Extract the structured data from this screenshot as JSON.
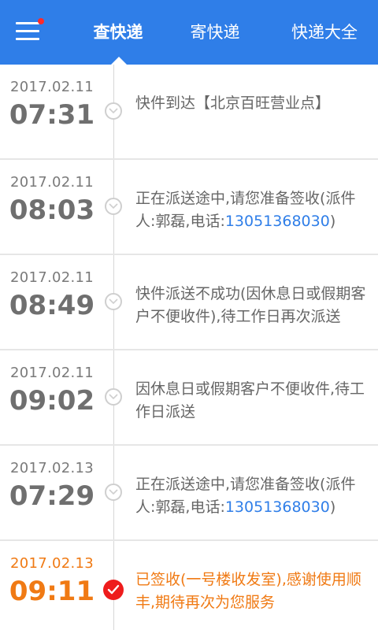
{
  "header": {
    "tabs": [
      {
        "label": "查快递",
        "active": true
      },
      {
        "label": "寄快递",
        "active": false
      },
      {
        "label": "快递大全",
        "active": false
      }
    ],
    "menu_icon": "hamburger-menu-icon",
    "notification_dot_color": "#ff2a2a",
    "accent_color": "#2f7ee8"
  },
  "timeline": [
    {
      "date": "2017.02.11",
      "time": "07:31",
      "message": "快件到达【北京百旺营业点】",
      "status": "past"
    },
    {
      "date": "2017.02.11",
      "time": "08:03",
      "message_pre": "正在派送途中,请您准备签收(派件人:郭磊,电话:",
      "phone": "13051368030",
      "message_post": ")",
      "status": "past"
    },
    {
      "date": "2017.02.11",
      "time": "08:49",
      "message": "快件派送不成功(因休息日或假期客户不便收件),待工作日再次派送",
      "status": "past"
    },
    {
      "date": "2017.02.11",
      "time": "09:02",
      "message": "因休息日或假期客户不便收件,待工作日派送",
      "status": "past"
    },
    {
      "date": "2017.02.13",
      "time": "07:29",
      "message_pre": "正在派送途中,请您准备签收(派件人:郭磊,电话:",
      "phone": "13051368030",
      "message_post": ")",
      "status": "past"
    },
    {
      "date": "2017.02.13",
      "time": "09:11",
      "message": "已签收(一号楼收发室),感谢使用顺丰,期待再次为您服务",
      "status": "delivered"
    }
  ],
  "colors": {
    "delivered": "#f07a14",
    "delivered_check": "#ee1c1c",
    "phone_link": "#2f7ee8"
  }
}
